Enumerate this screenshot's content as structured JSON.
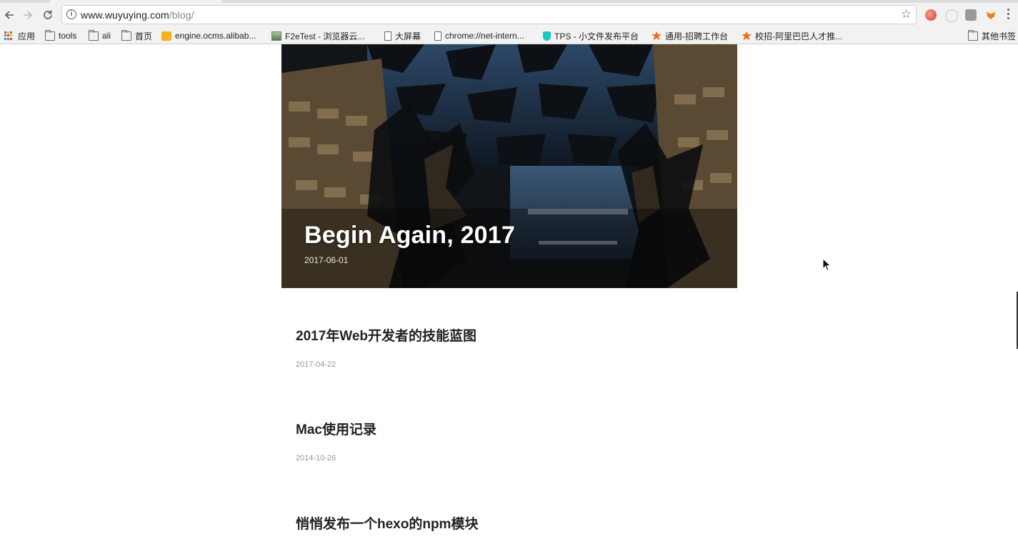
{
  "browser": {
    "url_host": "www.wuyuying.com",
    "url_path": "/blog/",
    "bookmarks": [
      {
        "label": "应用",
        "icon": "apps-grid-icon"
      },
      {
        "label": "tools",
        "icon": "folder-icon"
      },
      {
        "label": "ali",
        "icon": "folder-icon"
      },
      {
        "label": "首页",
        "icon": "folder-icon"
      },
      {
        "label": "engine.ocms.alibab...",
        "icon": "site-favicon-icon"
      },
      {
        "label": "F2eTest - 浏览器云...",
        "icon": "site-favicon-icon"
      },
      {
        "label": "大屏幕",
        "icon": "page-icon"
      },
      {
        "label": "chrome://net-intern...",
        "icon": "page-icon"
      },
      {
        "label": "TPS - 小文件发布平台",
        "icon": "site-favicon-icon"
      },
      {
        "label": "通用-招聘工作台",
        "icon": "site-favicon-icon"
      },
      {
        "label": "校招-阿里巴巴人才推...",
        "icon": "site-favicon-icon"
      }
    ],
    "other_bookmarks": "其他书签"
  },
  "hero": {
    "title": "Begin Again, 2017",
    "date": "2017-06-01"
  },
  "posts": [
    {
      "title": "2017年Web开发者的技能蓝图",
      "date": "2017-04-22"
    },
    {
      "title": "Mac使用记录",
      "date": "2014-10-26"
    },
    {
      "title": "悄悄发布一个hexo的npm模块",
      "date": ""
    }
  ]
}
